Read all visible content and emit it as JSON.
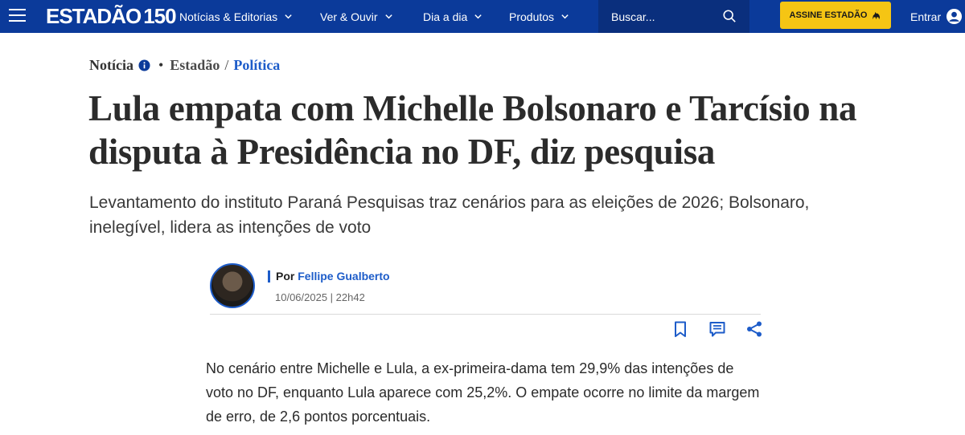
{
  "header": {
    "logo_text": "ESTADÃO",
    "logo_number": "150",
    "nav": [
      {
        "label": "Notícias & Editorias"
      },
      {
        "label": "Ver & Ouvir"
      },
      {
        "label": "Dia a dia"
      },
      {
        "label": "Produtos"
      }
    ],
    "search_placeholder": "Buscar...",
    "subscribe_label": "ASSINE ESTADÃO",
    "login_label": "Entrar",
    "colors": {
      "bar": "#0b3a9a",
      "search_bg": "#0a2f7d",
      "subscribe_bg": "#f5c514"
    }
  },
  "breadcrumb": {
    "type": "Notícia",
    "source": "Estadão",
    "separator": "/",
    "section": "Política"
  },
  "article": {
    "title": "Lula empata com Michelle Bolsonaro e Tarcísio na disputa à Presidência no DF, diz pesquisa",
    "subtitle": "Levantamento do instituto Paraná Pesquisas traz cenários para as eleições de 2026; Bolsonaro, inelegível, lidera as intenções de voto",
    "author_prefix": "Por",
    "author_name": "Fellipe Gualberto",
    "date": "10/06/2025 | 22h42",
    "body": "No cenário entre Michelle e Lula, a ex-primeira-dama tem 29,9% das intenções de voto no DF, enquanto Lula aparece com 25,2%. O empate ocorre no limite da margem de erro, de 2,6 pontos porcentuais."
  },
  "icons": {
    "menu": "hamburger-icon",
    "search": "search-icon",
    "user": "user-icon",
    "info": "info-icon",
    "bookmark": "bookmark-icon",
    "comment": "comment-icon",
    "share": "share-icon"
  },
  "accent": "#1d5cc9"
}
